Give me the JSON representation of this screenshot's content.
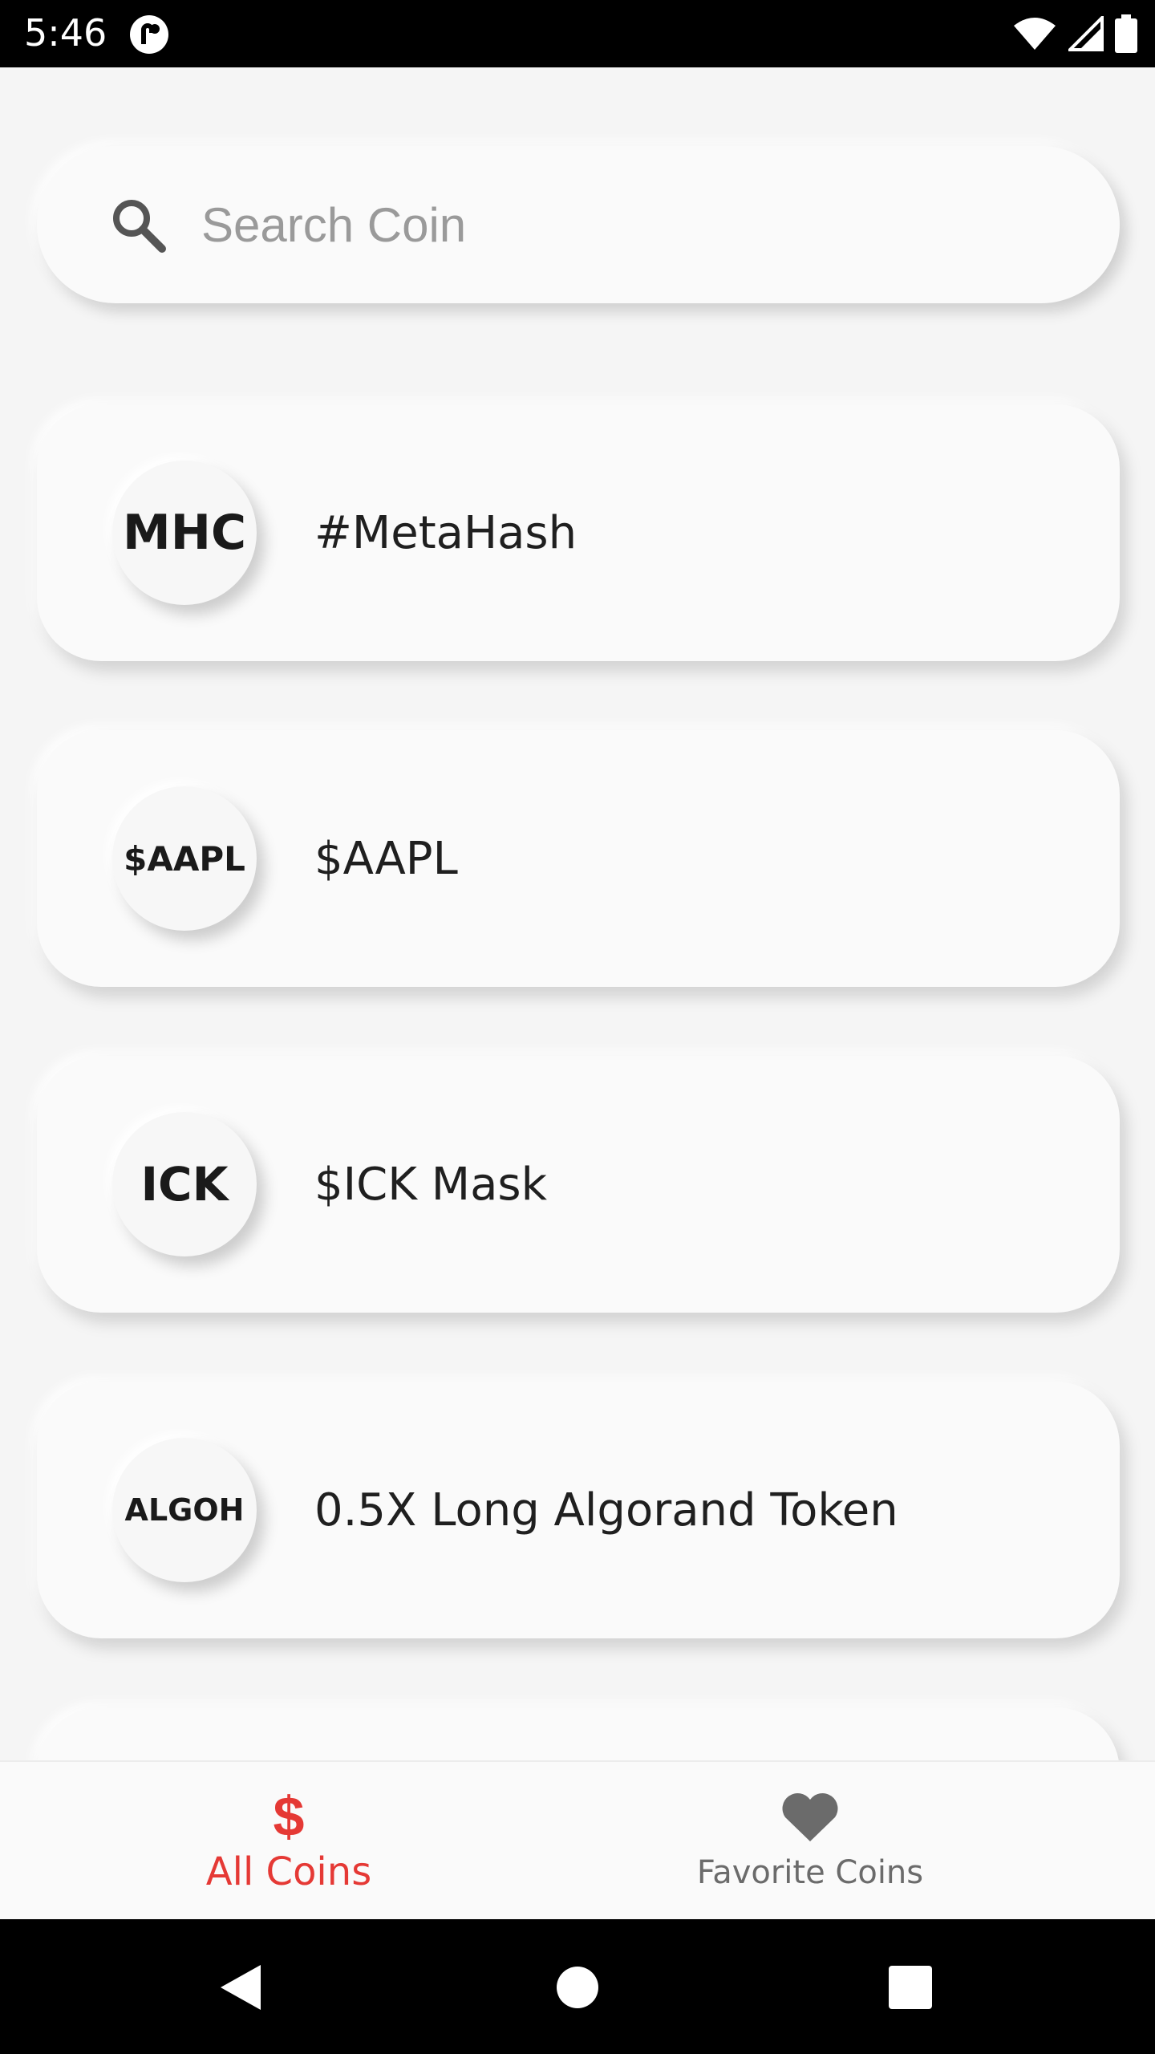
{
  "status_bar": {
    "time": "5:46",
    "icons": [
      "app-notification-icon",
      "wifi-icon",
      "cellular-signal-icon",
      "battery-icon"
    ]
  },
  "search": {
    "placeholder": "Search Coin",
    "value": "",
    "icon": "search-icon"
  },
  "coins": [
    {
      "symbol": "MHC",
      "name": "#MetaHash"
    },
    {
      "symbol": "$AAPL",
      "name": "$AAPL"
    },
    {
      "symbol": "ICK",
      "name": "$ICK Mask"
    },
    {
      "symbol": "ALGOH",
      "name": "0.5X Long Algorand Token"
    }
  ],
  "bottom_nav": {
    "items": [
      {
        "label": "All Coins",
        "icon": "dollar-icon",
        "active": true
      },
      {
        "label": "Favorite Coins",
        "icon": "heart-icon",
        "active": false
      }
    ]
  },
  "colors": {
    "accent": "#e53935",
    "background": "#f5f5f5",
    "card": "#fafafa",
    "inactive": "#6b6b6b"
  },
  "system_nav": {
    "buttons": [
      "back-icon",
      "home-icon",
      "recents-icon"
    ]
  }
}
